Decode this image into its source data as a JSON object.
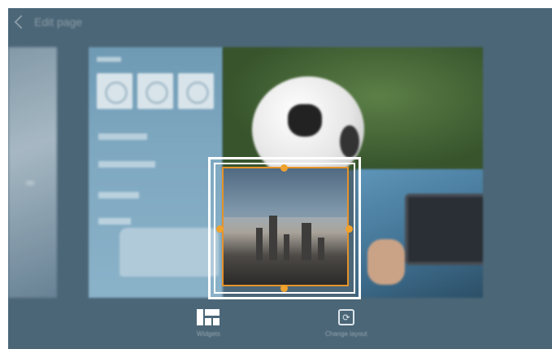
{
  "topbar": {
    "title": "Edit page",
    "back_icon": "chevron-left-icon"
  },
  "pages": {
    "left_page": "blurred-previous-page",
    "panels": [
      "blue-widget-panel",
      "soccer-photo-panel",
      "tablet-photo-panel"
    ]
  },
  "selected_widget": {
    "image": "city-skyline",
    "handles": [
      "top",
      "right",
      "bottom",
      "left"
    ]
  },
  "bottom_bar": {
    "widgets_label": "Widgets",
    "change_layout_label": "Change layout",
    "change_layout_glyph": "⟳"
  },
  "colors": {
    "background": "#4b6677",
    "accent": "#f0a22e",
    "selection": "#ffffff"
  }
}
